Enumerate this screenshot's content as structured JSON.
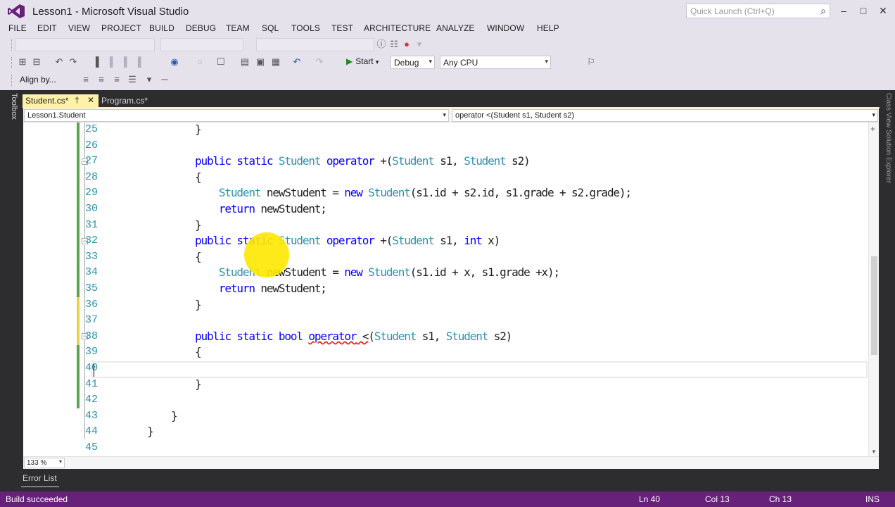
{
  "window": {
    "title": "Lesson1 - Microsoft Visual Studio",
    "quick_launch_placeholder": "Quick Launch (Ctrl+Q)"
  },
  "menu": [
    "FILE",
    "EDIT",
    "VIEW",
    "PROJECT",
    "BUILD",
    "DEBUG",
    "TEAM",
    "SQL",
    "TOOLS",
    "TEST",
    "ARCHITECTURE",
    "ANALYZE",
    "WINDOW",
    "HELP"
  ],
  "toolbar": {
    "start_label": "Start",
    "config": "Debug",
    "platform": "Any CPU",
    "align_label": "Align by..."
  },
  "side_panels": {
    "left": "Toolbox",
    "right": "Class View  Solution Explorer"
  },
  "tabs": [
    {
      "label": "Student.cs*",
      "active": true
    },
    {
      "label": "Program.cs*",
      "active": false
    }
  ],
  "navbar": {
    "type_scope": "Lesson1.Student",
    "member_scope": "operator <(Student s1, Student s2)"
  },
  "editor": {
    "lines": [
      {
        "num": "25",
        "tokens": [
          {
            "t": "        }"
          }
        ]
      },
      {
        "num": "26",
        "tokens": []
      },
      {
        "num": "27",
        "tokens": [
          {
            "t": "        "
          },
          {
            "t": "public",
            "c": "kw"
          },
          {
            "t": " "
          },
          {
            "t": "static",
            "c": "kw"
          },
          {
            "t": " "
          },
          {
            "t": "Student",
            "c": "ty"
          },
          {
            "t": " "
          },
          {
            "t": "operator",
            "c": "kw"
          },
          {
            "t": " +("
          },
          {
            "t": "Student",
            "c": "ty"
          },
          {
            "t": " s1, "
          },
          {
            "t": "Student",
            "c": "ty"
          },
          {
            "t": " s2)"
          }
        ]
      },
      {
        "num": "28",
        "tokens": [
          {
            "t": "        {"
          }
        ]
      },
      {
        "num": "29",
        "tokens": [
          {
            "t": "            "
          },
          {
            "t": "Student",
            "c": "ty"
          },
          {
            "t": " newStudent = "
          },
          {
            "t": "new",
            "c": "kw"
          },
          {
            "t": " "
          },
          {
            "t": "Student",
            "c": "ty"
          },
          {
            "t": "(s1.id + s2.id, s1.grade + s2.grade);"
          }
        ]
      },
      {
        "num": "30",
        "tokens": [
          {
            "t": "            "
          },
          {
            "t": "return",
            "c": "kw"
          },
          {
            "t": " newStudent;"
          }
        ]
      },
      {
        "num": "31",
        "tokens": [
          {
            "t": "        }"
          }
        ]
      },
      {
        "num": "32",
        "tokens": [
          {
            "t": "        "
          },
          {
            "t": "public",
            "c": "kw"
          },
          {
            "t": " "
          },
          {
            "t": "static",
            "c": "kw"
          },
          {
            "t": " "
          },
          {
            "t": "Student",
            "c": "ty"
          },
          {
            "t": " "
          },
          {
            "t": "operator",
            "c": "kw"
          },
          {
            "t": " +("
          },
          {
            "t": "Student",
            "c": "ty"
          },
          {
            "t": " s1, "
          },
          {
            "t": "int",
            "c": "kw"
          },
          {
            "t": " x)"
          }
        ]
      },
      {
        "num": "33",
        "tokens": [
          {
            "t": "        {"
          }
        ]
      },
      {
        "num": "34",
        "tokens": [
          {
            "t": "            "
          },
          {
            "t": "Student",
            "c": "ty"
          },
          {
            "t": " newStudent = "
          },
          {
            "t": "new",
            "c": "kw"
          },
          {
            "t": " "
          },
          {
            "t": "Student",
            "c": "ty"
          },
          {
            "t": "(s1.id + x, s1.grade +x);"
          }
        ]
      },
      {
        "num": "35",
        "tokens": [
          {
            "t": "            "
          },
          {
            "t": "return",
            "c": "kw"
          },
          {
            "t": " newStudent;"
          }
        ]
      },
      {
        "num": "36",
        "tokens": [
          {
            "t": "        }"
          }
        ]
      },
      {
        "num": "37",
        "tokens": []
      },
      {
        "num": "38",
        "tokens": [
          {
            "t": "        "
          },
          {
            "t": "public",
            "c": "kw"
          },
          {
            "t": " "
          },
          {
            "t": "static",
            "c": "kw"
          },
          {
            "t": " "
          },
          {
            "t": "bool",
            "c": "kw"
          },
          {
            "t": " "
          },
          {
            "t": "operator",
            "c": "kw err"
          },
          {
            "t": " <",
            "c": "err"
          },
          {
            "t": "("
          },
          {
            "t": "Student",
            "c": "ty"
          },
          {
            "t": " s1, "
          },
          {
            "t": "Student",
            "c": "ty"
          },
          {
            "t": " s2)"
          }
        ]
      },
      {
        "num": "39",
        "tokens": [
          {
            "t": "        {"
          }
        ]
      },
      {
        "num": "40",
        "tokens": []
      },
      {
        "num": "41",
        "tokens": [
          {
            "t": "        }"
          }
        ]
      },
      {
        "num": "42",
        "tokens": []
      },
      {
        "num": "43",
        "tokens": [
          {
            "t": "    }"
          }
        ]
      },
      {
        "num": "44",
        "tokens": [
          {
            "t": "}"
          }
        ]
      },
      {
        "num": "45",
        "tokens": []
      }
    ],
    "zoom": "133 %"
  },
  "bottom": {
    "error_list_tab": "Error List"
  },
  "status": {
    "message": "Build succeeded",
    "ln": "Ln 40",
    "col": "Col 13",
    "ch": "Ch 13",
    "mode": "INS"
  },
  "colors": {
    "status_bar": "#68217a",
    "keyword": "#0000ff",
    "type": "#2b91af",
    "line_number": "#2b91af",
    "active_tab": "#fff1a8"
  }
}
